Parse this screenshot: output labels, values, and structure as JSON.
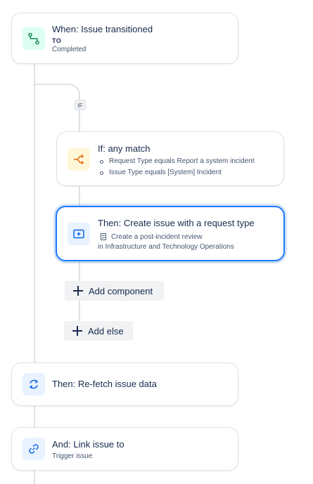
{
  "trigger": {
    "title": "When: Issue transitioned",
    "to_label": "TO",
    "status": "Completed"
  },
  "branch": {
    "badge": "IF"
  },
  "condition": {
    "title": "If: any match",
    "items": [
      "Request Type equals Report a system incident",
      "Issue Type equals [System] Incident"
    ]
  },
  "create_issue": {
    "title": "Then: Create issue with a request type",
    "summary": "Create a post-incident review",
    "project": "in Infrastructure and Technology Operations"
  },
  "buttons": {
    "add_component": "Add component",
    "add_else": "Add else"
  },
  "refetch": {
    "title": "Then: Re-fetch issue data"
  },
  "link": {
    "title": "And: Link issue to",
    "target": "Trigger issue"
  },
  "colors": {
    "trigger_icon_bg": "#dcfff1",
    "trigger_icon": "#1f845a",
    "condition_icon_bg": "#fff7d6",
    "condition_icon": "#e56910",
    "action_icon_bg": "#e9f2ff",
    "action_icon": "#0c66e4",
    "selected_border": "#1d7afc",
    "connector": "#dfe1e6"
  },
  "icons": {
    "trigger": "transition-icon",
    "condition": "branch-condition-icon",
    "create": "create-issue-icon",
    "refetch": "refresh-icon",
    "link": "link-icon",
    "doc": "request-type-icon"
  }
}
